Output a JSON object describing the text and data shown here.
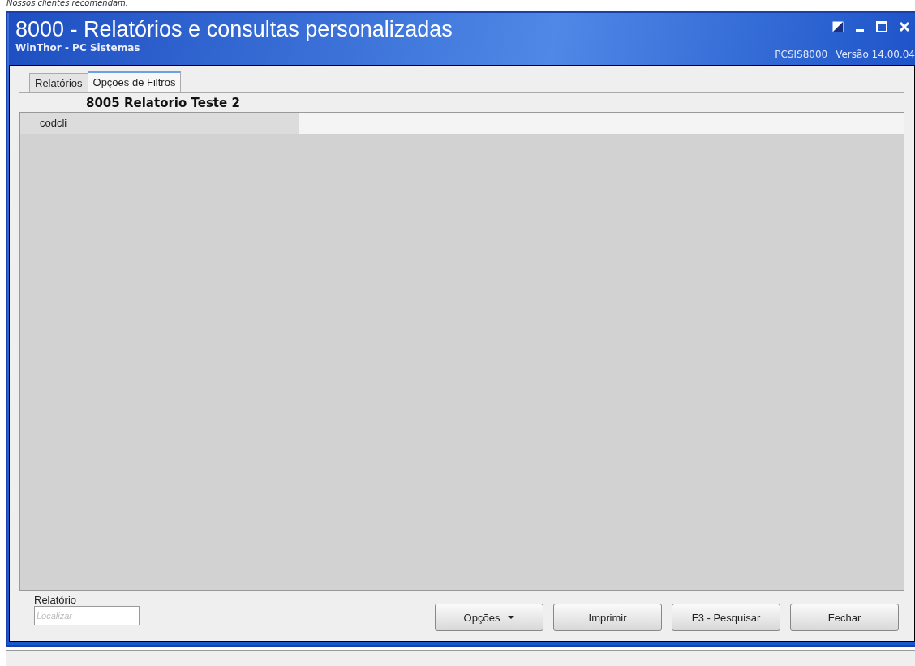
{
  "caption": "Nossos clientes recomendam.",
  "window": {
    "title": "8000 - Relatórios e consultas personalizadas",
    "subtitle": "WinThor - PC Sistemas",
    "program_code": "PCSIS8000",
    "version": "Versão 14.00.04"
  },
  "tabs": [
    {
      "label": "Relatórios",
      "selected": false
    },
    {
      "label": "Opções de Filtros",
      "selected": true
    }
  ],
  "report_title": "8005 Relatorio Teste 2",
  "filters": [
    {
      "name": "codcli"
    }
  ],
  "search": {
    "label": "Relatório",
    "placeholder": "Localizar"
  },
  "buttons": [
    {
      "label": "Opções",
      "kind": "dropdown"
    },
    {
      "label": "Imprimir",
      "kind": "plain"
    },
    {
      "label": "F3 - Pesquisar",
      "kind": "plain"
    },
    {
      "label": "Fechar",
      "kind": "plain"
    }
  ]
}
